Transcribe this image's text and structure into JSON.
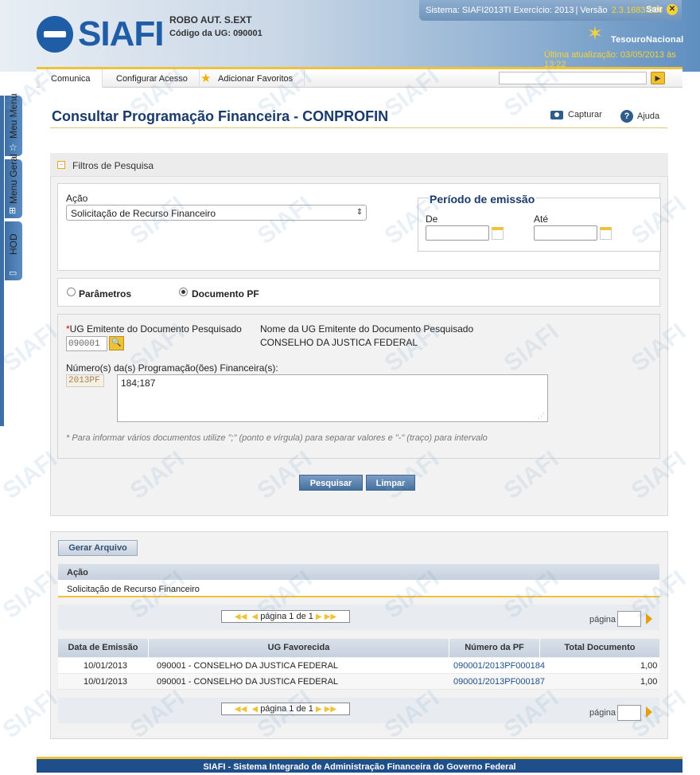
{
  "header": {
    "logo_text": "SIAFI",
    "user_name": "ROBO AUT. S.EXT",
    "ug_label": "Código da UG:",
    "ug_code": "090001",
    "system_info": "Sistema: SIAFI2013TI Exercício: 2013",
    "version_label": "Versão",
    "version": "2.3.1683.228",
    "logout_label": "Sair",
    "tesouro_text": "TesouroNacional",
    "last_update": "Última atualização: 03/05/2013 às 13:22"
  },
  "menu": {
    "items": [
      {
        "label": "Comunica"
      },
      {
        "label": "Configurar Acesso"
      },
      {
        "label": "Adicionar Favoritos"
      }
    ]
  },
  "sidetabs": {
    "items": [
      {
        "label": "Meu Menu"
      },
      {
        "label": "Menu Geral"
      },
      {
        "label": "HOD"
      }
    ]
  },
  "page": {
    "title": "Consultar Programação Financeira - CONPROFIN",
    "capture_label": "Capturar",
    "help_label": "Ajuda"
  },
  "filters": {
    "section_title": "Filtros de Pesquisa",
    "acao_label": "Ação",
    "acao_value": "Solicitação de Recurso Financeiro",
    "periodo_title": "Período de emissão",
    "de_label": "De",
    "ate_label": "Até",
    "radio_parametros": "Parâmetros",
    "radio_documento": "Documento PF",
    "ug_label": "UG Emitente do Documento Pesquisado",
    "ug_required": "*",
    "ug_value": "090001",
    "ug_name_label": "Nome da UG Emitente do Documento Pesquisado",
    "ug_name": "CONSELHO DA JUSTICA FEDERAL",
    "pf_label": "Número(s) da(s) Programação(ões) Financeira(s):",
    "pf_prefix": "2013PF",
    "pf_value": "184;187",
    "hint": "* Para informar vários documentos utilize \";\" (ponto e vírgula) para separar valores e \"-\" (traço) para intervalo",
    "search_button": "Pesquisar",
    "clear_button": "Limpar"
  },
  "results": {
    "generate_button": "Gerar Arquivo",
    "acao_header": "Ação",
    "acao_value": "Solicitação de Recurso Financeiro",
    "pager_text": "página 1 de 1",
    "page_label": "página",
    "columns": [
      "Data de Emissão",
      "UG Favorecida",
      "Número da PF",
      "Total Documento"
    ],
    "rows": [
      {
        "date": "10/01/2013",
        "ug": "090001 - CONSELHO DA JUSTICA FEDERAL",
        "pf": "090001/2013PF000184",
        "total": "1,00"
      },
      {
        "date": "10/01/2013",
        "ug": "090001 - CONSELHO DA JUSTICA FEDERAL",
        "pf": "090001/2013PF000187",
        "total": "1,00"
      }
    ]
  },
  "footer": {
    "text": "SIAFI - Sistema Integrado de Administração Financeira do Governo Federal"
  },
  "colors": {
    "brand_blue": "#1f5da6",
    "accent_yellow": "#f0c23a",
    "title_blue": "#1a3a6a"
  }
}
